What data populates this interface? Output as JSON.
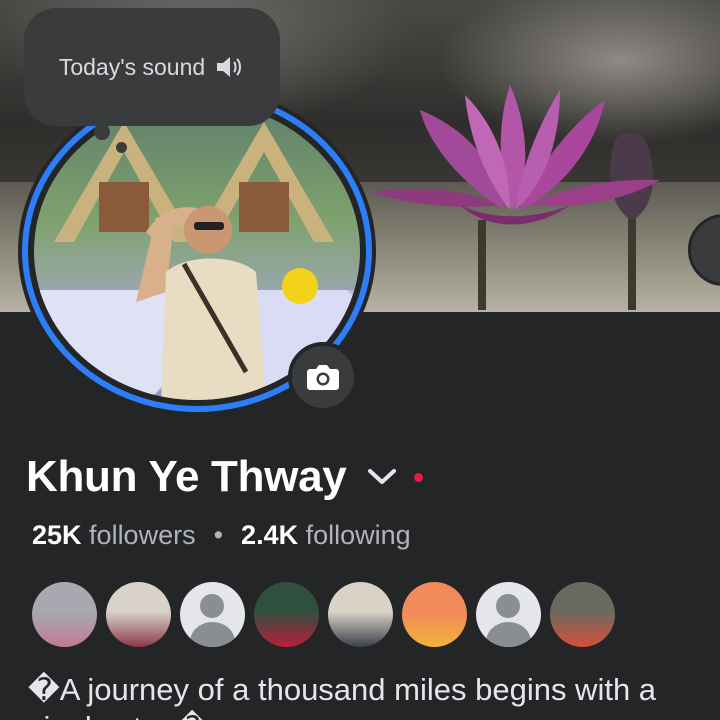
{
  "sound_bubble": {
    "label": "Today's sound",
    "icon": "speaker-icon"
  },
  "profile": {
    "name": "Khun Ye Thway",
    "followers_count": "25K",
    "followers_label": "followers",
    "separator": "•",
    "following_count": "2.4K",
    "following_label": "following",
    "bio_line1": "�A journey of a thousand miles begins with a",
    "bio_line2": "single step�"
  },
  "friends": [
    {
      "kind": "photo",
      "colors": [
        "#a8a8b0",
        "#c27b92"
      ]
    },
    {
      "kind": "photo",
      "colors": [
        "#d8d2c8",
        "#8b3a4a"
      ]
    },
    {
      "kind": "default"
    },
    {
      "kind": "photo",
      "colors": [
        "#2f4f3f",
        "#b8203a"
      ]
    },
    {
      "kind": "photo",
      "colors": [
        "#d9d2c7",
        "#3b3f48"
      ]
    },
    {
      "kind": "photo",
      "colors": [
        "#f28a5c",
        "#f2b23a"
      ]
    },
    {
      "kind": "default"
    },
    {
      "kind": "photo",
      "colors": [
        "#6a6a60",
        "#d84f3b"
      ]
    }
  ],
  "colors": {
    "accent": "#2d7ff9",
    "background": "#242526",
    "notification": "#e41e3f"
  }
}
